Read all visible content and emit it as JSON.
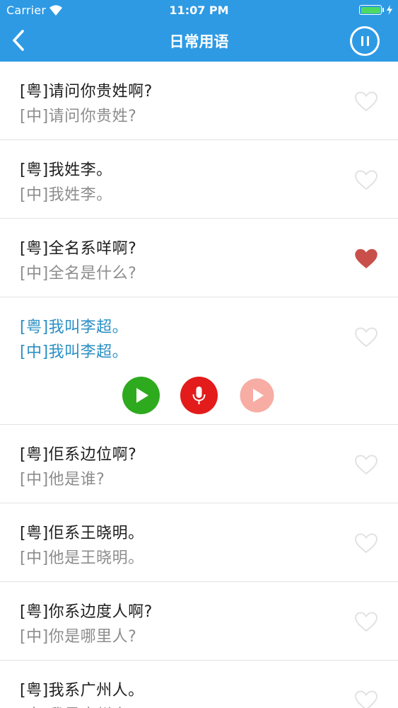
{
  "status_bar": {
    "carrier": "Carrier",
    "time": "11:07 PM",
    "battery_color": "#4cd964"
  },
  "nav": {
    "title": "日常用语",
    "back_icon": "chevron-left-icon",
    "pause_icon": "pause-circle-icon",
    "background": "#2e9ae4"
  },
  "phrases": [
    {
      "yue": "[粤]请问你贵姓啊?",
      "zh": "[中]请问你贵姓?",
      "favorited": false
    },
    {
      "yue": "[粤]我姓李。",
      "zh": "[中]我姓李。",
      "favorited": false
    },
    {
      "yue": "[粤]全名系咩啊?",
      "zh": "[中]全名是什么?",
      "favorited": true
    },
    {
      "yue": "[粤]我叫李超。",
      "zh": "[中]我叫李超。",
      "favorited": false,
      "selected": true
    },
    {
      "yue": "[粤]佢系边位啊?",
      "zh": "[中]他是谁?",
      "favorited": false
    },
    {
      "yue": "[粤]佢系王晓明。",
      "zh": "[中]他是王晓明。",
      "favorited": false
    },
    {
      "yue": "[粤]你系边度人啊?",
      "zh": "[中]你是哪里人?",
      "favorited": false
    },
    {
      "yue": "[粤]我系广州人。",
      "zh": "[中]我是广州人。",
      "favorited": false
    }
  ],
  "playback_controls": {
    "play_color": "#2eaa1e",
    "record_color": "#e31b1b",
    "playback_color": "#f7aca4"
  },
  "colors": {
    "favorite_active": "#c9504a",
    "favorite_inactive": "#e2e2e2",
    "selected_text": "#2a8fc5"
  }
}
